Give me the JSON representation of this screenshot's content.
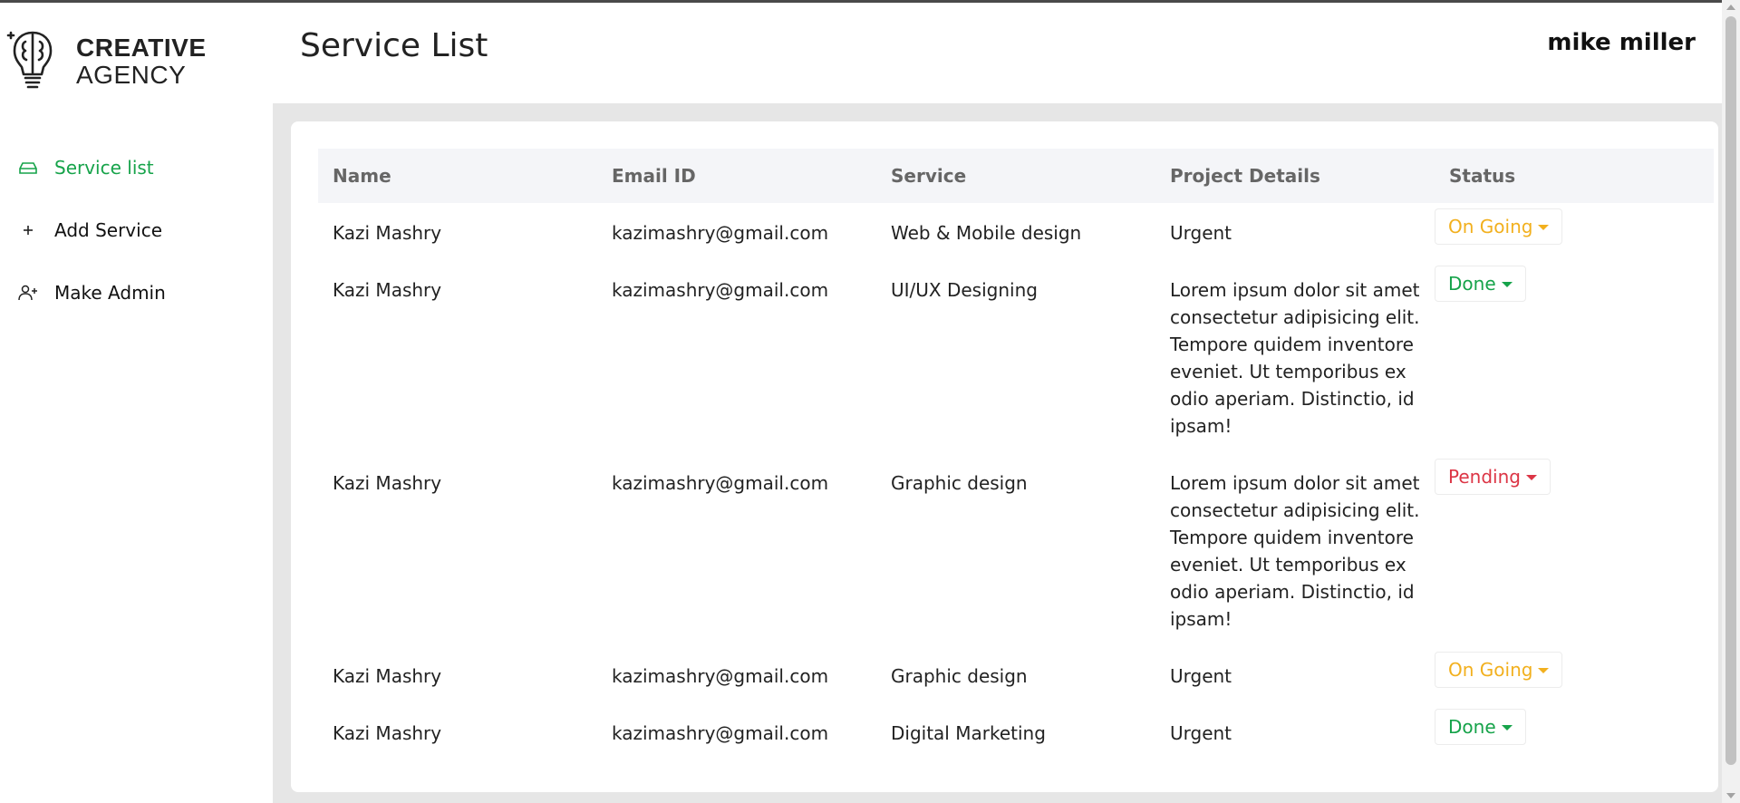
{
  "brand": {
    "line1": "CREATIVE",
    "line2": "AGENCY"
  },
  "sidebar": {
    "items": [
      {
        "label": "Service list",
        "icon": "service-list-icon",
        "active": true
      },
      {
        "label": "Add Service",
        "icon": "plus-icon",
        "active": false
      },
      {
        "label": "Make Admin",
        "icon": "user-plus-icon",
        "active": false
      }
    ]
  },
  "header": {
    "title": "Service List",
    "user": "mike miller"
  },
  "table": {
    "columns": [
      "Name",
      "Email ID",
      "Service",
      "Project Details",
      "Status"
    ],
    "rows": [
      {
        "name": "Kazi Mashry",
        "email": "kazimashry@gmail.com",
        "service": "Web & Mobile design",
        "details": "Urgent",
        "status": "On Going"
      },
      {
        "name": "Kazi Mashry",
        "email": "kazimashry@gmail.com",
        "service": "UI/UX Designing",
        "details": "Lorem ipsum dolor sit amet consectetur adipisicing elit. Tempore quidem inventore eveniet. Ut temporibus ex odio aperiam. Distinctio, id ipsam!",
        "status": "Done"
      },
      {
        "name": "Kazi Mashry",
        "email": "kazimashry@gmail.com",
        "service": "Graphic design",
        "details": "Lorem ipsum dolor sit amet consectetur adipisicing elit. Tempore quidem inventore eveniet. Ut temporibus ex odio aperiam. Distinctio, id ipsam!",
        "status": "Pending"
      },
      {
        "name": "Kazi Mashry",
        "email": "kazimashry@gmail.com",
        "service": "Graphic design",
        "details": "Urgent",
        "status": "On Going"
      },
      {
        "name": "Kazi Mashry",
        "email": "kazimashry@gmail.com",
        "service": "Digital Marketing",
        "details": "Urgent",
        "status": "Done"
      }
    ]
  },
  "colors": {
    "accent": "#16a34a",
    "on_going": "#f2b01e",
    "done": "#16a34a",
    "pending": "#dc3545"
  }
}
